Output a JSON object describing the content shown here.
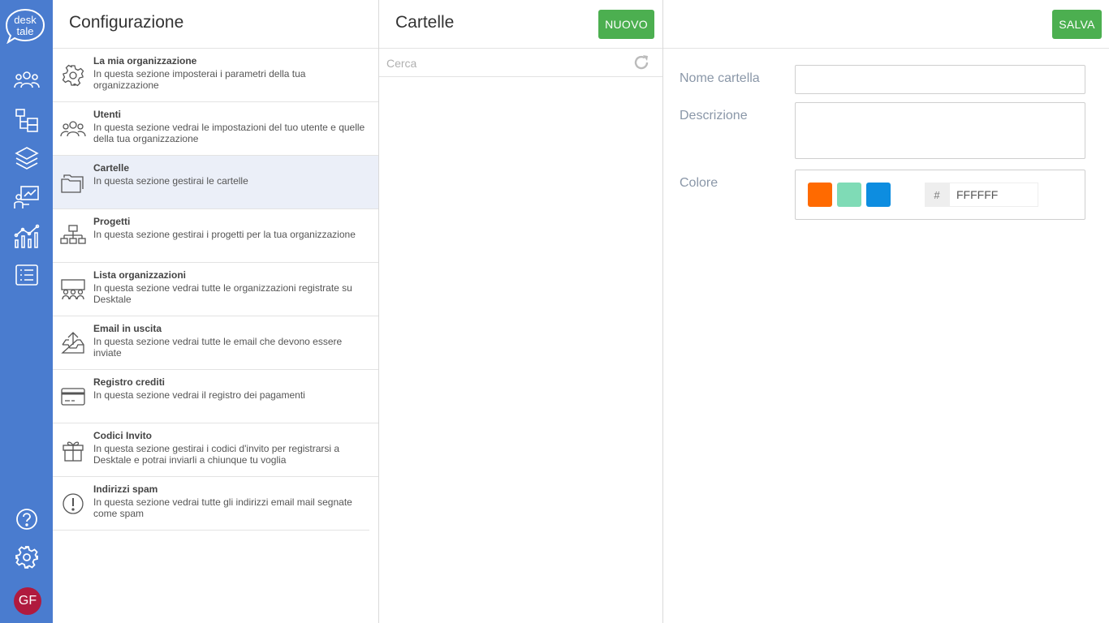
{
  "logo": {
    "line1": "desk",
    "line2": "tale"
  },
  "rail": {
    "items": [
      {
        "name": "users-icon"
      },
      {
        "name": "folder-tree-icon"
      },
      {
        "name": "layers-icon"
      },
      {
        "name": "presentation-icon"
      },
      {
        "name": "analytics-icon"
      },
      {
        "name": "list-icon"
      }
    ],
    "help": "help-icon",
    "settings": "gear-icon",
    "avatar": "GF"
  },
  "config": {
    "title": "Configurazione",
    "items": [
      {
        "title": "La mia organizzazione",
        "desc": "In questa sezione imposterai i parametri della tua organizzazione",
        "icon": "gear-icon"
      },
      {
        "title": "Utenti",
        "desc": "In questa sezione vedrai le impostazioni del tuo utente e quelle della tua organizzazione",
        "icon": "users-icon"
      },
      {
        "title": "Cartelle",
        "desc": "In questa sezione gestirai le cartelle",
        "icon": "folders-icon"
      },
      {
        "title": "Progetti",
        "desc": "In questa sezione gestirai i progetti per la tua organizzazione",
        "icon": "hierarchy-icon"
      },
      {
        "title": "Lista organizzazioni",
        "desc": "In questa sezione vedrai tutte le organizzazioni registrate su Desktale",
        "icon": "organizations-icon"
      },
      {
        "title": "Email in uscita",
        "desc": "In questa sezione vedrai tutte le email che devono essere inviate",
        "icon": "outbox-icon"
      },
      {
        "title": "Registro crediti",
        "desc": "In questa sezione vedrai il registro dei pagamenti",
        "icon": "credit-card-icon"
      },
      {
        "title": "Codici Invito",
        "desc": "In questa sezione gestirai i codici d'invito per registrarsi a Desktale e potrai inviarli a chiunque tu voglia",
        "icon": "gift-icon"
      },
      {
        "title": "Indirizzi spam",
        "desc": "In questa sezione vedrai tutte gli indirizzi email mail segnate come spam",
        "icon": "warning-icon"
      }
    ]
  },
  "folders": {
    "title": "Cartelle",
    "new_label": "NUOVO",
    "search_placeholder": "Cerca"
  },
  "detail": {
    "save_label": "SALVA",
    "name_label": "Nome cartella",
    "name_value": "",
    "description_label": "Descrizione",
    "description_value": "",
    "color_label": "Colore",
    "swatches": [
      "#ff6a00",
      "#7fdbb6",
      "#0d8de0"
    ],
    "hash": "#",
    "hex_value": "FFFFFF"
  }
}
